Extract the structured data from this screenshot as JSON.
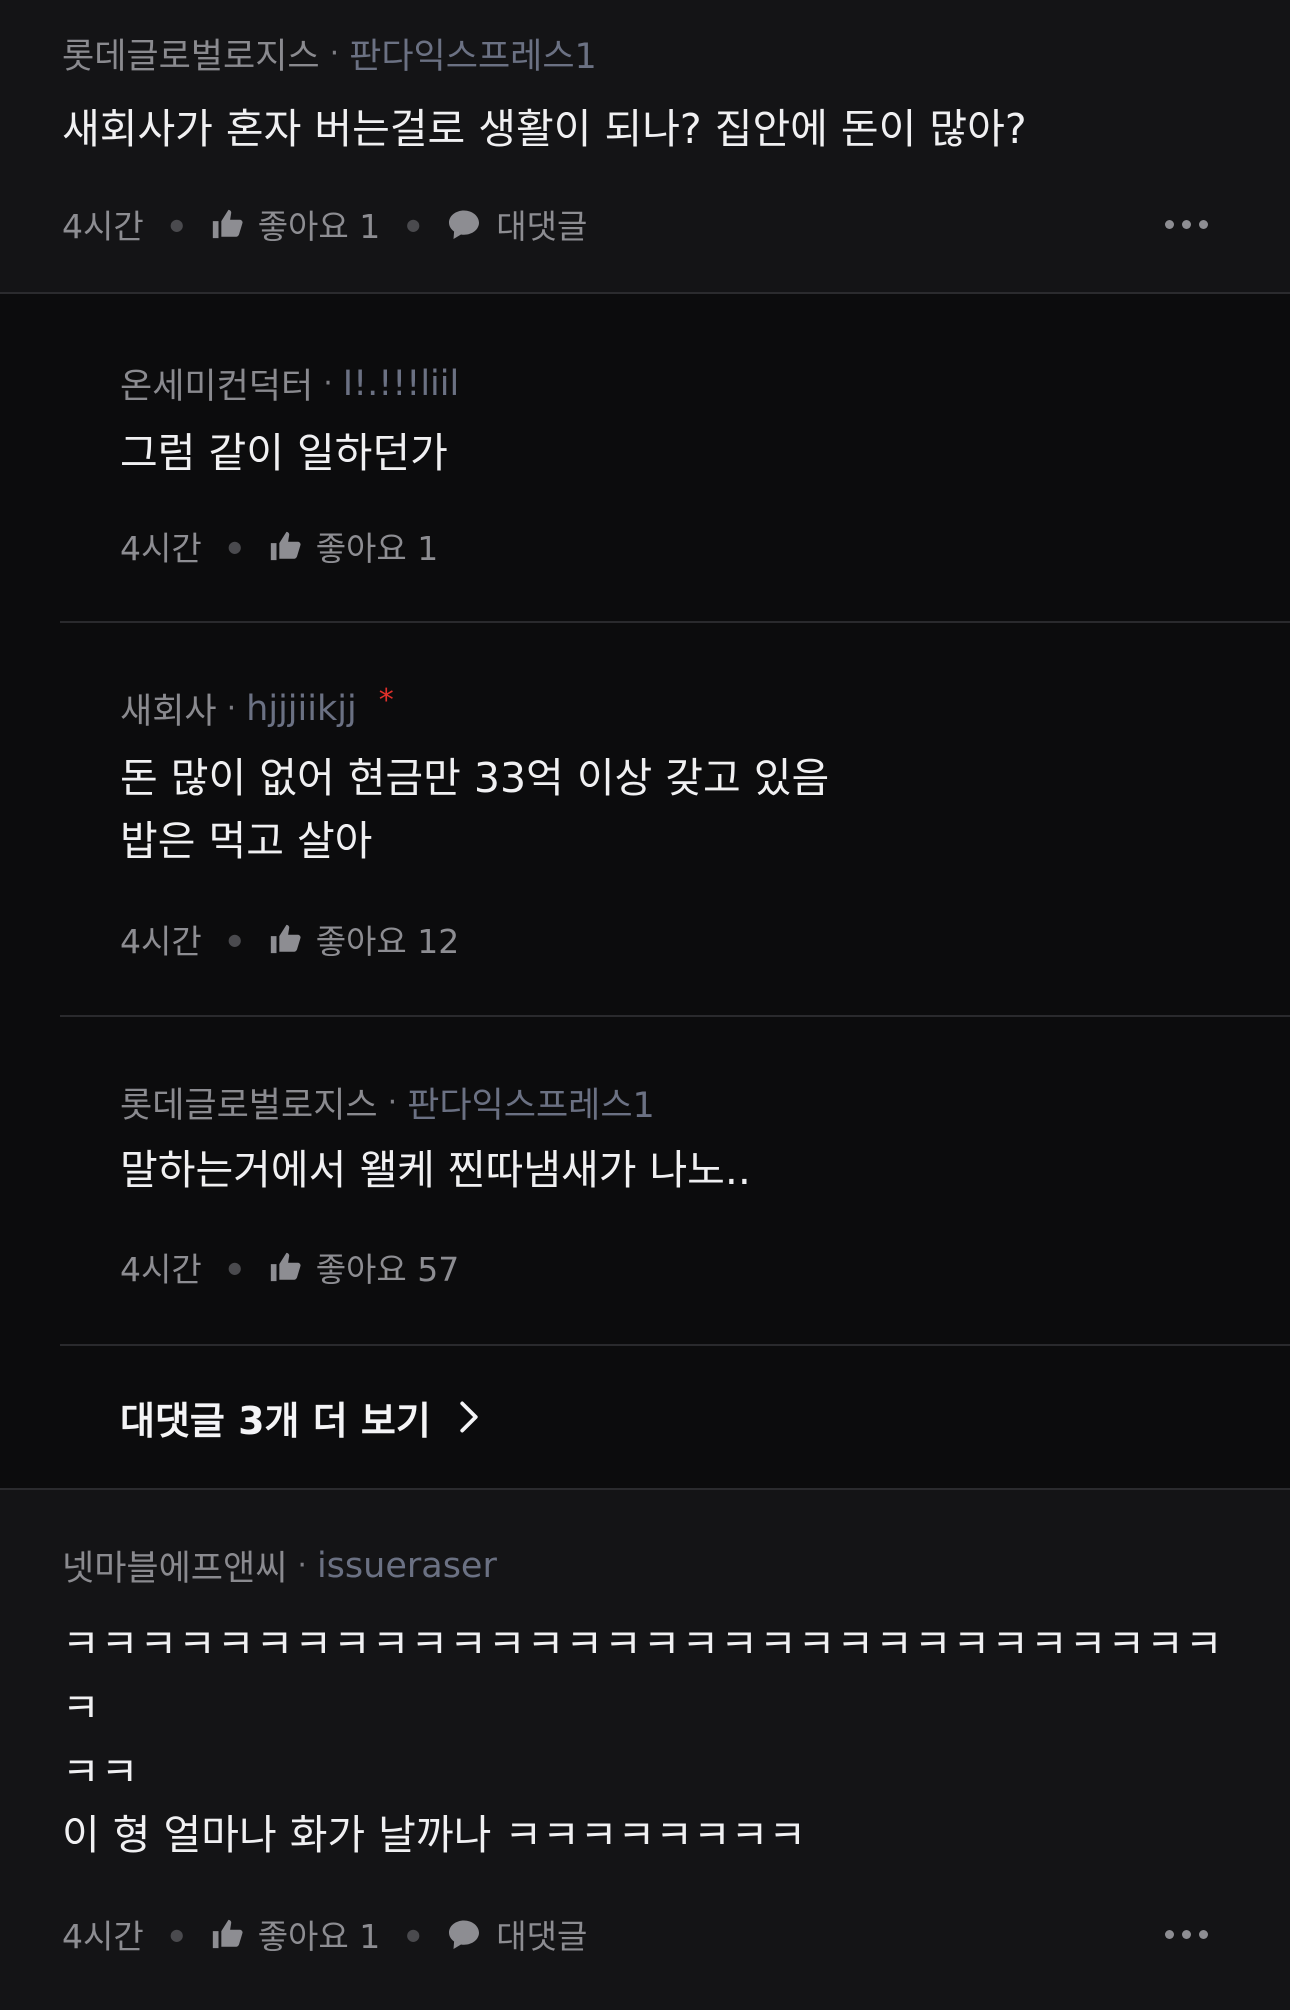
{
  "colors": {
    "background": "#141416",
    "reply_background": "#0c0c0d",
    "company": "#6b7183",
    "op_marker": "#e0302b"
  },
  "comments": [
    {
      "author": "롯데글로벌로지스",
      "company": "판다익스프레스1",
      "text": "새회사가 혼자 버는걸로 생활이 되나? 집안에 돈이 많아?",
      "time": "4시간",
      "like_label": "좋아요 1",
      "reply_label": "대댓글",
      "replies": [
        {
          "author": "온세미컨덕터",
          "company": "I!.!!!liil",
          "text": "그럼 같이 일하던가",
          "time": "4시간",
          "like_label": "좋아요 1"
        },
        {
          "author": "새회사",
          "company": "hjjjiikjj",
          "op_marker": "*",
          "text": "돈 많이 없어 현금만 33억 이상 갖고 있음\n밥은 먹고 살아",
          "time": "4시간",
          "like_label": "좋아요 12"
        },
        {
          "author": "롯데글로벌로지스",
          "company": "판다익스프레스1",
          "text": "말하는거에서 왤케 찐따냄새가 나노..",
          "time": "4시간",
          "like_label": "좋아요 57"
        }
      ],
      "see_more_label": "대댓글 3개 더 보기"
    },
    {
      "author": "넷마블에프앤씨",
      "company": "issueraser",
      "text_line1": "ㅋㅋㅋㅋㅋㅋㅋㅋㅋㅋㅋㅋㅋㅋㅋㅋㅋㅋㅋㅋㅋㅋㅋㅋㅋㅋㅋㅋㅋㅋㅋ\nㅋㅋ",
      "text_line2": "이 형 얼마나 화가 날까나 ㅋㅋㅋㅋㅋㅋㅋㅋ",
      "time": "4시간",
      "like_label": "좋아요 1",
      "reply_label": "대댓글"
    }
  ],
  "icons": {
    "like": "thumbs-up-icon",
    "reply": "speech-bubble-icon",
    "more": "more-horizontal-icon",
    "chevron": "chevron-right-icon"
  }
}
